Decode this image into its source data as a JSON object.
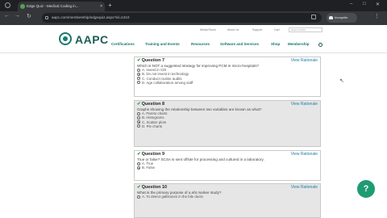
{
  "browser": {
    "tab_title": "Edge Quiz - Medical Coding in...",
    "new_tab": "+",
    "tab_close": "×",
    "url": "aapc.com/membership/edgequiz.aspx?id=2410",
    "incognito": "Incognito",
    "back": "←",
    "forward": "→",
    "reload": "↻",
    "menu": "⋮",
    "minimize": "–",
    "maximize": "□",
    "close": "✕"
  },
  "site": {
    "logo": "AAPC",
    "top_links": [
      "Media Room",
      "About Us",
      "Support",
      "Cart",
      "Cookie Statement"
    ],
    "search_placeholder": "Search AAPC",
    "nav": [
      "Certifications",
      "Training and Events",
      "Resources",
      "Software and Services",
      "Shop",
      "Membership"
    ]
  },
  "questions": [
    {
      "title": "Question 7",
      "rationale": "View Rationale",
      "text": "Which is NOT a suggested strategy for improving PCM in micro-hospitals?",
      "options": [
        "A. Invest in CDI",
        "B. Do not invest in technology",
        "C. Conduct routine audits",
        "D. Age collaboration among staff"
      ],
      "selected": 1
    },
    {
      "title": "Question 8",
      "rationale": "View Rationale",
      "text": "Graphs showing the relationship between two variables are known as what?",
      "options": [
        "A. Pareto charts",
        "B. Histograms",
        "C. Scatter plots",
        "D. Pie charts"
      ],
      "selected": 2
    },
    {
      "title": "Question 9",
      "rationale": "View Rationale",
      "text": "True or false? SCSA is sent offsite for processing and cultured in a laboratory.",
      "options": [
        "A. True",
        "B. False"
      ],
      "selected": 1
    },
    {
      "title": "Question 10",
      "rationale": "View Rationale",
      "text": "What is the primary purpose of a ebt marker study?",
      "options": [
        "A. To detect gallstones in the bile ducts"
      ],
      "selected": -1
    }
  ],
  "fab": "?"
}
